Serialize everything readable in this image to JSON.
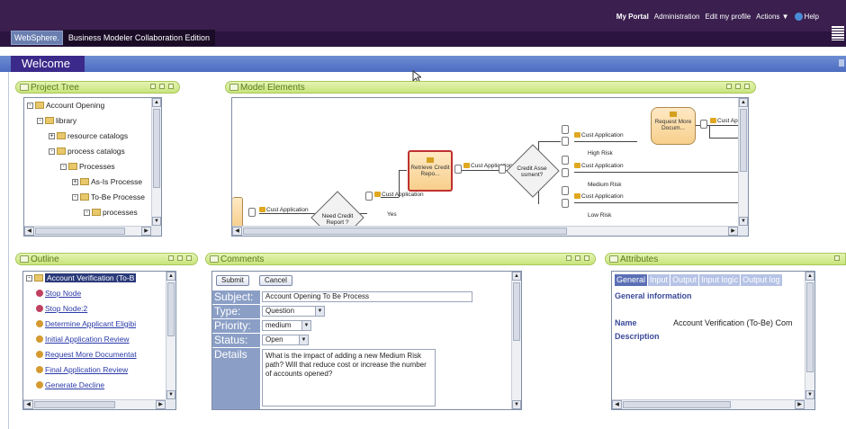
{
  "header": {
    "portal_links": [
      "My Portal",
      "Administration",
      "Edit my profile",
      "Actions ▼",
      "Help"
    ],
    "brand_short": "WebSphere.",
    "brand_edition": "Business Modeler Collaboration Edition"
  },
  "welcome_tab": "Welcome",
  "project_tree": {
    "title": "Project Tree",
    "items": [
      {
        "label": "Account Opening",
        "indent": 0
      },
      {
        "label": "library",
        "indent": 1
      },
      {
        "label": "resource catalogs",
        "indent": 2
      },
      {
        "label": "process catalogs",
        "indent": 2
      },
      {
        "label": "Processes",
        "indent": 3
      },
      {
        "label": "As-Is Processe",
        "indent": 4
      },
      {
        "label": "To-Be Processe",
        "indent": 4
      },
      {
        "label": "processes",
        "indent": 5
      }
    ]
  },
  "model_elements": {
    "title": "Model Elements",
    "tasks": {
      "retrieve": "Retrieve Credit Repo...",
      "request": "Request More Docum..."
    },
    "decisions": {
      "need_credit": "Need Credit Report ?",
      "credit_assess": "Credit Asse ssment?"
    },
    "cust_app_label": "Cust Application",
    "cust_ap_cut": "Cust Ap",
    "branches": [
      "High Risk",
      "Medium Risk",
      "Low Risk"
    ],
    "yes_label": "Yes"
  },
  "outline": {
    "title": "Outline",
    "root": "Account Verification (To-B",
    "items": [
      "Stop Node",
      "Stop Node:2",
      "Determine Applicant Eligibi",
      "Initial Application Review",
      "Request More Documentat",
      "Final Application Review",
      "Generate Decline"
    ]
  },
  "comments": {
    "title": "Comments",
    "submit": "Submit",
    "cancel": "Cancel",
    "subject_label": "Subject:",
    "subject_value": "Account Opening To Be Process",
    "type_label": "Type:",
    "type_value": "Question",
    "priority_label": "Priority:",
    "priority_value": "medium",
    "status_label": "Status:",
    "status_value": "Open",
    "details_label": "Details",
    "details_value": "What is the impact of adding a new Medium Risk path?  Will that reduce cost or increase the number of accounts opened?"
  },
  "attributes": {
    "title": "Attributes",
    "tabs": [
      "General",
      "Input",
      "Output",
      "Input logic",
      "Output log"
    ],
    "section": "General information",
    "name_label": "Name",
    "name_value": "Account Verification (To-Be) Com",
    "description_label": "Description"
  },
  "colors": {
    "header_bg": "#3a1f4f",
    "welcome_bar": "#5a78c8",
    "panel_title": "#c8e47c",
    "link": "#2a3aa8"
  }
}
